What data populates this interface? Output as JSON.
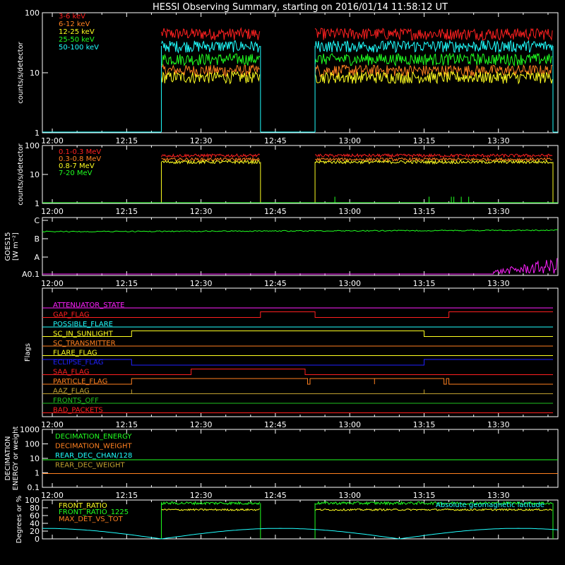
{
  "title": "HESSI Observing Summary, starting on 2016/01/14 11:58:12 UT",
  "time_ticks": [
    "12:00",
    "12:15",
    "12:30",
    "12:45",
    "13:00",
    "13:15",
    "13:30"
  ],
  "colors": {
    "red": "#ff2020",
    "orange": "#ff8020",
    "yellow": "#ffff20",
    "green": "#20ff20",
    "cyan": "#20ffff",
    "magenta": "#ff20ff",
    "blue": "#2020ff",
    "olive": "#c0a030",
    "drkgreen": "#20c020",
    "white": "#ffffff"
  },
  "chart_data": [
    {
      "id": "panel1",
      "type": "line",
      "ylabel": "counts/s/detector",
      "yscale": "log",
      "ylim": [
        1,
        100
      ],
      "ytick_labels": [
        "1",
        "10",
        "100"
      ],
      "ytick_values": [
        1,
        10,
        100
      ],
      "legend_placement": "top-left",
      "series": [
        {
          "name": "3-6 keV",
          "color": "red",
          "level": 45
        },
        {
          "name": "6-12 keV",
          "color": "orange",
          "level": 11
        },
        {
          "name": "12-25 keV",
          "color": "yellow",
          "level": 8.5
        },
        {
          "name": "25-50 keV",
          "color": "green",
          "level": 17
        },
        {
          "name": "50-100 keV",
          "color": "cyan",
          "level": 28
        }
      ]
    },
    {
      "id": "panel2",
      "type": "line",
      "ylabel": "counts/s/detector",
      "yscale": "log",
      "ylim": [
        1,
        100
      ],
      "ytick_labels": [
        "1",
        "10",
        "100"
      ],
      "ytick_values": [
        1,
        10,
        100
      ],
      "legend_placement": "top-left",
      "series": [
        {
          "name": "0.1-0.3 MeV",
          "color": "red",
          "level": 45
        },
        {
          "name": "0.3-0.8 MeV",
          "color": "orange",
          "level": 33
        },
        {
          "name": "0.8-7 MeV",
          "color": "yellow",
          "level": 27
        },
        {
          "name": "7-20 MeV",
          "color": "green",
          "level": 1
        }
      ]
    },
    {
      "id": "panel3",
      "type": "line",
      "ylabel": "GOES15",
      "ylabel2": "[W m⁻²]",
      "ytick_labels": [
        "A0.1",
        "A",
        "B",
        "C"
      ]
    },
    {
      "id": "panel4",
      "type": "line",
      "ylabel": "Flags",
      "flags": [
        {
          "name": "ATTENUATOR_STATE",
          "color": "magenta"
        },
        {
          "name": "GAP_FLAG",
          "color": "red"
        },
        {
          "name": "POSSIBLE_FLARE",
          "color": "cyan"
        },
        {
          "name": "SC_IN_SUNLIGHT",
          "color": "yellow"
        },
        {
          "name": "SC_TRANSMITTER",
          "color": "orange"
        },
        {
          "name": "FLARE_FLAG",
          "color": "yellow"
        },
        {
          "name": "ECLIPSE_FLAG",
          "color": "blue"
        },
        {
          "name": "SAA_FLAG",
          "color": "red"
        },
        {
          "name": "PARTICLE_FLAG",
          "color": "orange"
        },
        {
          "name": "AAZ_FLAG",
          "color": "olive"
        },
        {
          "name": "FRONTS_OFF",
          "color": "drkgreen"
        },
        {
          "name": "BAD_PACKETS",
          "color": "red"
        }
      ]
    },
    {
      "id": "panel5",
      "type": "line",
      "ylabel": "DECIMATION",
      "ylabel2": "ENERGY or weight",
      "yscale": "log",
      "ylim": [
        0.1,
        1000
      ],
      "ytick_labels": [
        "0.1",
        "1",
        "10",
        "100",
        "1000"
      ],
      "ytick_values": [
        0.1,
        1,
        10,
        100,
        1000
      ],
      "series": [
        {
          "name": "DECIMATION_ENERGY",
          "color": "green",
          "level": 8
        },
        {
          "name": "DECIMATION_WEIGHT",
          "color": "orange",
          "level": 0.9
        },
        {
          "name": "REAR_DEC_CHAN/128",
          "color": "cyan"
        },
        {
          "name": "REAR_DEC_WEIGHT",
          "color": "olive"
        }
      ]
    },
    {
      "id": "panel6",
      "type": "line",
      "ylabel": "Degrees or %",
      "ylim": [
        0,
        100
      ],
      "ytick_labels": [
        "0",
        "20",
        "40",
        "60",
        "80",
        "100"
      ],
      "ytick_values": [
        0,
        20,
        40,
        60,
        80,
        100
      ],
      "series": [
        {
          "name": "FRONT_RATIO",
          "color": "yellow",
          "level": 75
        },
        {
          "name": "FRONT_RATIO_1225",
          "color": "green",
          "level": 92
        },
        {
          "name": "MAX_DET_VS_TOT",
          "color": "orange"
        },
        {
          "name": "Absolute geomagnetic latitude",
          "color": "cyan"
        }
      ]
    }
  ]
}
